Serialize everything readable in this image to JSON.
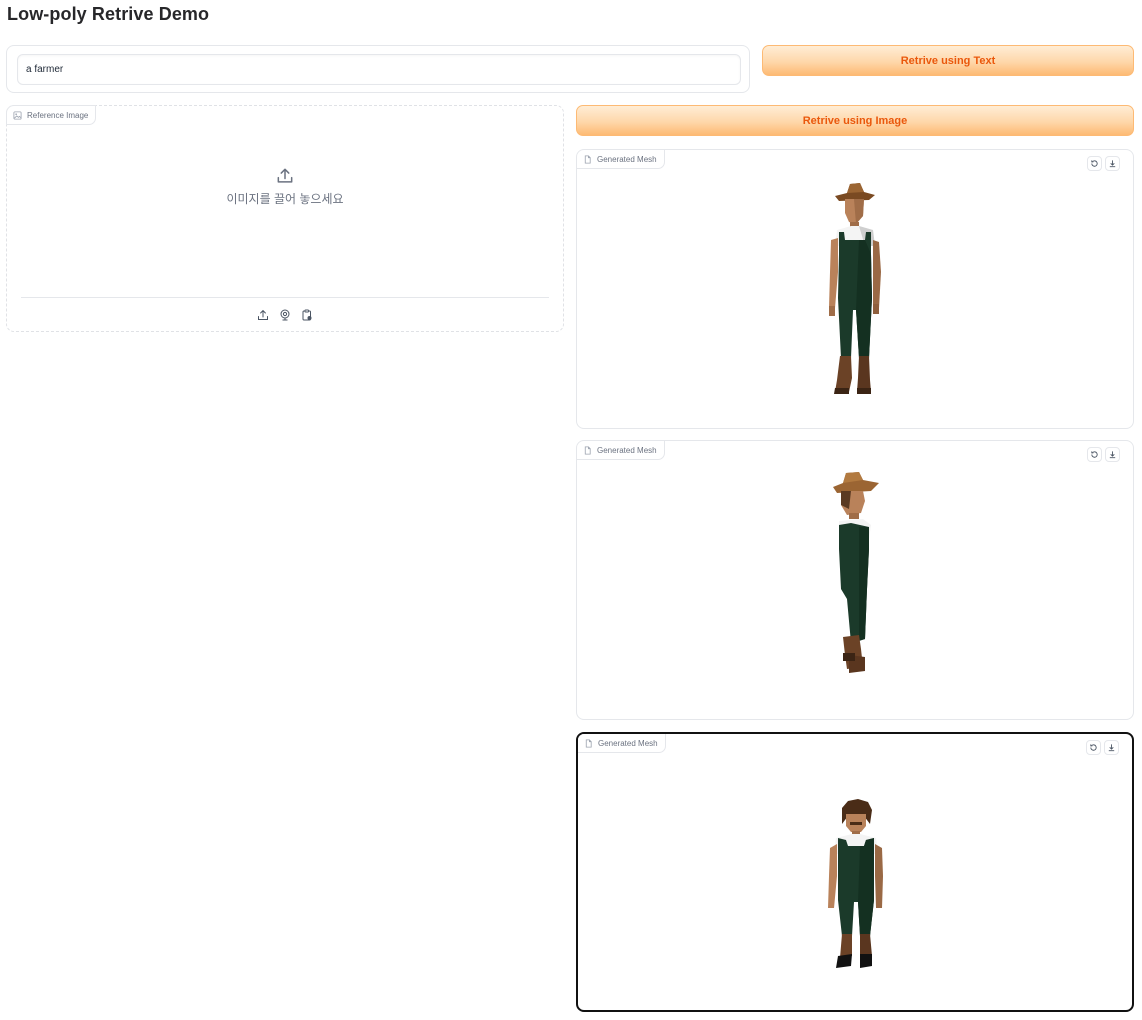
{
  "app": {
    "title": "Low-poly Retrive Demo"
  },
  "text_query": {
    "value": "a farmer",
    "button_label": "Retrive using Text"
  },
  "reference": {
    "label": "Reference Image",
    "drop_text": "이미지를 끌어 놓으세요",
    "sources": [
      "upload-icon",
      "webcam-icon",
      "clipboard-icon"
    ]
  },
  "image_query": {
    "button_label": "Retrive using Image"
  },
  "results": [
    {
      "label": "Generated Mesh",
      "pose": "front view, farmer with brown cowboy hat, white shirt, green overalls, brown boots"
    },
    {
      "label": "Generated Mesh",
      "pose": "side view, farmer with brown cowboy hat"
    },
    {
      "label": "Generated Mesh",
      "pose": "front view, farmer with curly hair and mustache, green overalls"
    }
  ],
  "colors": {
    "accent_orange": "#ea580c",
    "button_gradient_top": "#ffedd5",
    "button_gradient_bottom": "#fdba74",
    "overalls_green": "#1b3a2a",
    "skin": "#b9825a",
    "hat_brown": "#8b5a2b",
    "boots_brown": "#6b4226"
  }
}
